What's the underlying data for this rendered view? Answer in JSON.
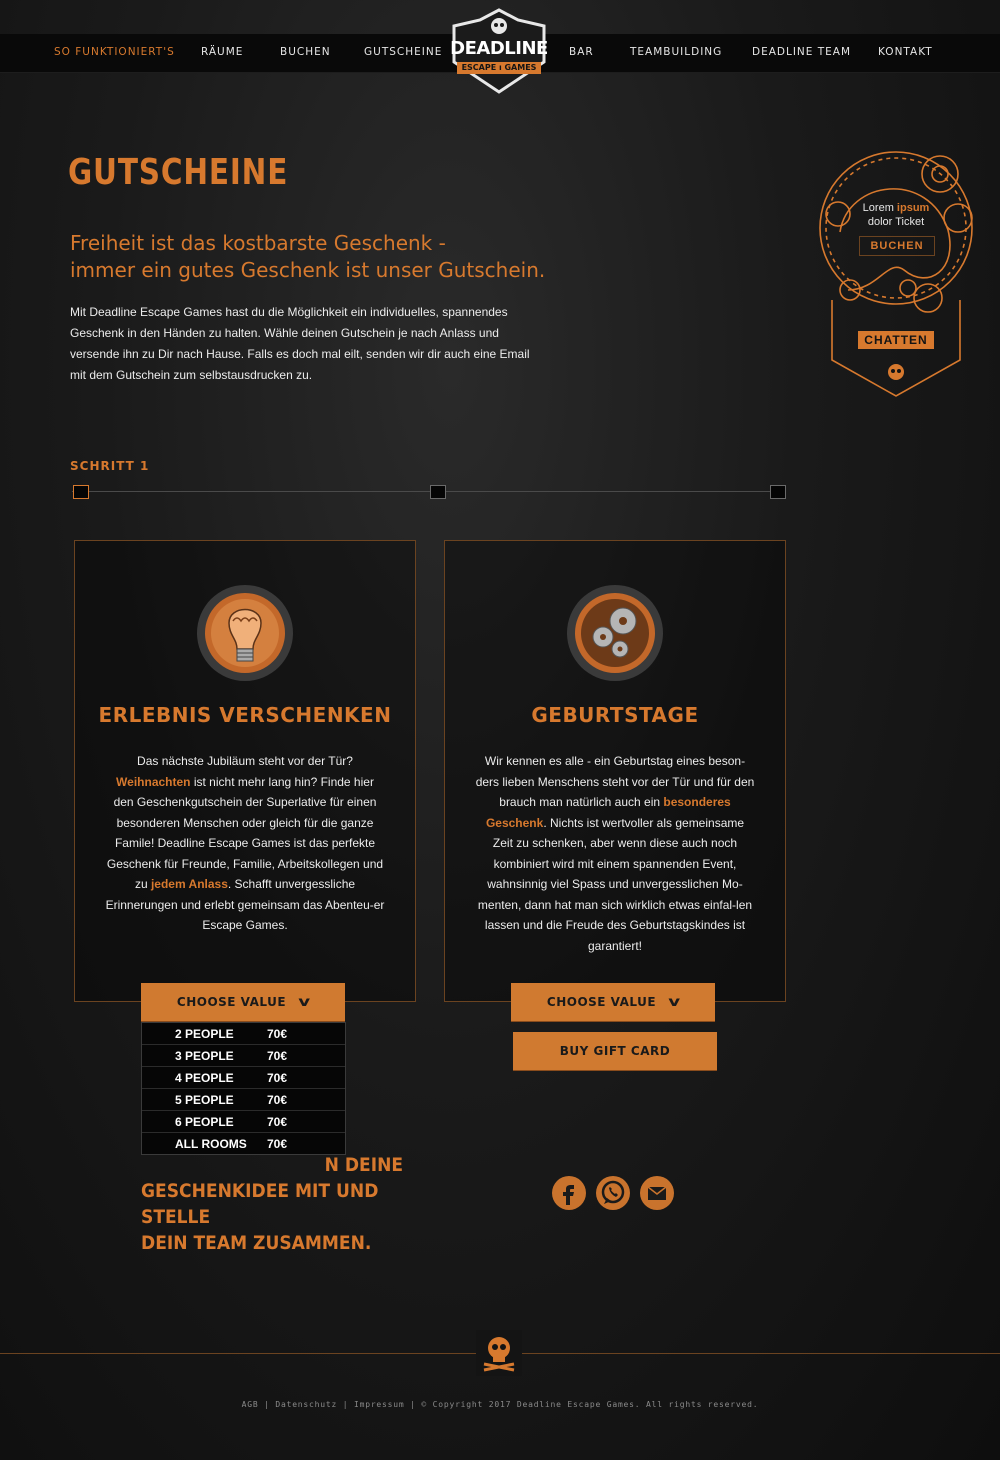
{
  "nav": {
    "items": [
      "SO FUNKTIONIERT'S",
      "RÄUME",
      "BUCHEN",
      "GUTSCHEINE",
      "BAR",
      "TEAMBUILDING",
      "DEADLINE TEAM",
      "KONTAKT"
    ],
    "active_index": 0
  },
  "logo": {
    "title": "DEADLINE",
    "subtitle": "ESCAPE ı GAMES"
  },
  "page": {
    "title": "GUTSCHEINE",
    "subtitle_line1": "Freiheit ist das kostbarste Geschenk -",
    "subtitle_line2": "immer ein gutes Geschenk ist unser Gutschein.",
    "intro": "Mit Deadline Escape Games hast du die Möglichkeit ein individuelles, spannendes Geschenk in den Händen zu halten. Wähle deinen Gutschein je nach Anlass und versende ihn zu Dir nach Hause. Falls es doch mal eilt, senden wir dir auch eine Email mit dem Gutschein zum selbstausdrucken zu."
  },
  "ticket": {
    "line1_a": "Lorem ",
    "line1_b": "ipsum",
    "line2": "dolor Ticket",
    "book_label": "BUCHEN",
    "chat_label": "CHATTEN"
  },
  "steps": {
    "label": "SCHRITT 1",
    "count": 3,
    "current": 1
  },
  "cards": [
    {
      "icon": "lightbulb-brain-icon",
      "title": "ERLEBNIS VERSCHENKEN",
      "body": [
        {
          "t": "Das nächste Jubiläum steht vor der Tür? "
        },
        {
          "t": "Weihnachten",
          "hl": true
        },
        {
          "t": " ist nicht mehr lang hin? Finde hier den Geschenkgutschein der Superlative  für einen besonderen Menschen oder gleich für die ganze Famile! Deadline Escape Games ist das perfekte Geschenk für Freunde, Familie, Arbeitskollegen und zu "
        },
        {
          "t": "jedem Anlass",
          "hl": true
        },
        {
          "t": ".  Schafft unvergessliche Erinnerungen und erlebt gemeinsam das Abenteu-er Escape Games."
        }
      ],
      "button": "CHOOSE VALUE"
    },
    {
      "icon": "gears-icon",
      "title": "GEBURTSTAGE",
      "body": [
        {
          "t": "Wir kennen es alle - ein Geburtstag eines beson-ders lieben Menschens steht vor der Tür und für den brauch man natürlich auch ein "
        },
        {
          "t": "besonderes Geschenk",
          "hl": true
        },
        {
          "t": ". Nichts ist wertvoller als gemeinsame Zeit zu schenken, aber wenn diese auch noch kombiniert wird mit einem spannenden Event, wahnsinnig viel Spass und unvergesslichen Mo-menten, dann hat man sich wirklich etwas einfal-len lassen und die Freude des Geburtstagskindes ist garantiert!"
        }
      ],
      "button": "CHOOSE VALUE",
      "buy_button": "BUY GIFT CARD"
    }
  ],
  "dropdown": {
    "options": [
      {
        "label": "2 PEOPLE",
        "price": "70€"
      },
      {
        "label": "3 PEOPLE",
        "price": "70€"
      },
      {
        "label": "4 PEOPLE",
        "price": "70€"
      },
      {
        "label": "5 PEOPLE",
        "price": "70€"
      },
      {
        "label": "6 PEOPLE",
        "price": "70€"
      },
      {
        "label": "ALL ROOMS",
        "price": "70€"
      }
    ]
  },
  "teaser": {
    "line1_visible": "N DEINE",
    "line2": "GESCHENKIDEE MIT UND STELLE",
    "line3": "DEIN TEAM ZUSAMMEN."
  },
  "social": [
    "facebook-icon",
    "whatsapp-icon",
    "email-icon"
  ],
  "footer": {
    "text": "AGB | Datenschutz | Impressum | © Copyright 2017  Deadline Escape Games. All rights reserved."
  },
  "colors": {
    "accent": "#d7792e",
    "background": "#141414"
  }
}
